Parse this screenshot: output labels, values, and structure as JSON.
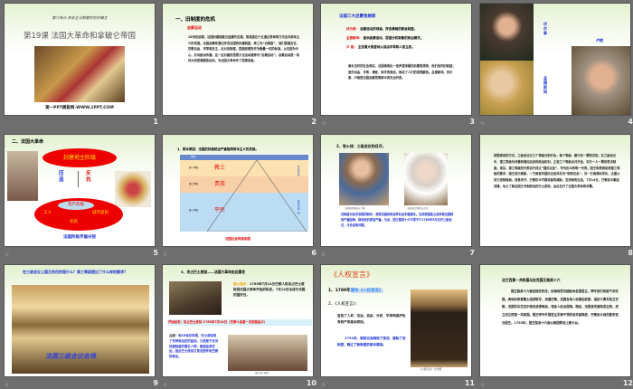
{
  "transition_icon": "transition-icon",
  "slides": [
    {
      "number": "1",
      "subtitle": "第六单元 资本主义制度的初步确立",
      "title": "第19课 法国大革命和拿破仑帝国",
      "footer": "第一PPT模板网-WWW.1PPT.COM"
    },
    {
      "number": "2",
      "heading": "一、旧制度的危机",
      "sub": "启蒙运动",
      "text": "18世纪前期，法国封建制度日益腐朽没落。而英国在十五通过革命等方式走向资本主义的发展。法国启蒙家通过抨击法国的封建制度，称之为“旧制度”，他们提倡言论、宗教自由、平等和民主，反对旧制度，提倡把理性作为衡量一切的标准。以法国为中心，并向欧洲传播，这一反封建的思想文化运动被称为“启蒙运动”。启蒙运动是一场伟大的思想解放运动，为法国大革命作了思想准备。"
    },
    {
      "number": "3",
      "heading": "法国三大启蒙思想家",
      "items": [
        {
          "name": "伏尔泰：",
          "desc": "启蒙运动的领袖，抨击黑暗的教会制度。"
        },
        {
          "name": "孟德斯鸠：",
          "desc": "欧洲启蒙运动，提倡分权制衡的政治模式。"
        },
        {
          "name": "卢  梭：",
          "desc": "主张最大限度地以自由平等和人民主权。"
        }
      ],
      "text": "面对当时的社会现实，法国涌现出一批声望卓著的启蒙思想家，他们批判旧制度，宣传自由、平等、博爱、科学的观念，推动了人们的思想解放。孟德斯鸠、伏尔泰、卢梭是法国启蒙思想家中的杰出代表。"
    },
    {
      "number": "4",
      "labels": [
        "伏尔泰",
        "卢梭",
        "孟德斯鸠"
      ]
    },
    {
      "number": "5",
      "heading": "二、法国大革命",
      "top": "封建地主阶级",
      "left": "压迫",
      "right": "反抗",
      "center": "资产阶级",
      "workers": "工人",
      "poor": "城市贫民",
      "farmers": "农民",
      "caption": "法国阶级矛盾尖锐"
    },
    {
      "number": "6",
      "heading": "1、根本原因：法国的封建统治严重阻碍资本主义的发展。",
      "col": "等级",
      "rows": [
        {
          "level": "第一等级",
          "name": "教士"
        },
        {
          "level": "第二等级",
          "name": "贵族"
        },
        {
          "level": "第三等级",
          "name": "平民"
        }
      ],
      "side": [
        "特权等级",
        "被统治等级"
      ],
      "caption": "法国社会等级制度"
    },
    {
      "number": "7",
      "heading": "2、导火线：三级会议的召开。",
      "cap1": "法国国王路易十六像",
      "cap2": "法国王后玛丽·安东尼",
      "text": "旧制度对经济发展的制约，使得法国政府各种社会矛盾激化。支持美国独立战争使法国财政严重困难，财政危机更加严重。为此，国王路易十六不得不于1789年5月召开三级会议，讨论征税问题。"
    },
    {
      "number": "8",
      "text": "按照原来的方式，三级会议分三个等级分别开会，每个等级，都只有一票表决权。在三级会议中，第三等级为改善和增加自身的政治权利，主张三个等级合并开会，实行一人一票的表决制度。来后，第三等级的代表自行成立“国民议会”，作为民众的唯一代表。国王和贵族拒绝第三等级的要求，国王进行威胁，一方面宣布国民议会改名为“制宪议会”，另一方面调动军队，企图以武力控制局面。消息传开，巴黎民众不顾武装的威胁，支持制宪议会。7月14日，巴黎民众拿起武器，攻占了象征国王专制统治的巴士底狱，由此拉开了法国大革命的序幕。"
    },
    {
      "number": "9",
      "question": "在三级会议上国王的目的是什么？第三等级提出了什么样的要求？",
      "caption": "法国三级会议会场"
    },
    {
      "number": "10",
      "heading": "3、攻占巴士底狱——法国大革命由此爆发",
      "hint_label": "核心提示：",
      "hint": "1789年7月14日巴黎人民攻占巴士底狱是法国大革命开始的标志。7月14日也成为法国的国庆日。",
      "start": "开始标志：攻占巴士底狱  1789年7月14日（巴黎人民第一次武装起义）",
      "note_label": "点拨：",
      "note": "到18世纪末期，巴士底狱成了关押政治犯的监狱。凡是敢于反对封建制度的著名人物，都被监禁在此。因此巴士底狱又是法国专制王朝的象征。",
      "caption": "攻占巴士底狱"
    },
    {
      "number": "11",
      "heading": "《人权宣言》",
      "l1a": "1、1789年",
      "l1b": "颁布《人权宣言》",
      "l2": "2、《人权宣言》：",
      "text": "宣告了人权、法治、自由、分权、平等和保护私有财产等基本原则。",
      "text2": "1791年，制宪议会制定了宪法，废除了旧制度，确立了新制度的基本框架。",
      "caption": "《人权宣言》全文图"
    },
    {
      "number": "12",
      "heading": "法兰西第一共和国与处死国王路易十六",
      "text": "国王路易十六被迫接受宪法，但暗地里勾结欧洲各国君主，呼吁他们武装干涉法国。奥地利和普鲁士组成联军，进逼巴黎。法国各地人民拿起武器，组织义勇军保卫巴黎。法国军队在瓦尔密击退侵略者，将敌人赶出国境。随后，法国宣布废除君主制，成立法兰西第一共和国。国王呼吁外国君主军事干预的信件被揭发，巴黎民众强烈要求惩办国王。1793年，国王路易十六被以叛国罪送上断头台。"
    }
  ]
}
